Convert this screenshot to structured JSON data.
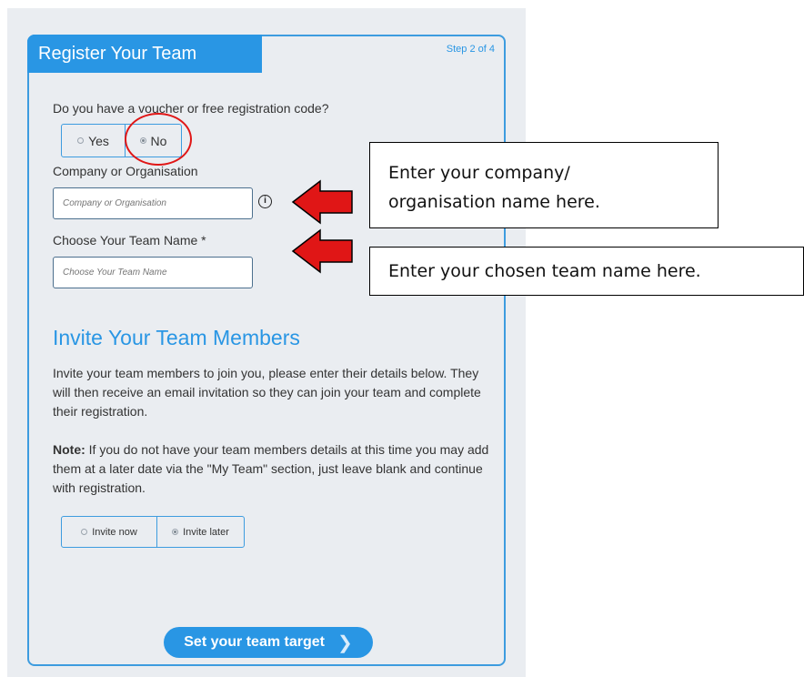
{
  "form": {
    "title": "Register Your Team",
    "step": "Step 2 of 4",
    "voucher_question": "Do you have a voucher or free registration code?",
    "voucher_options": [
      "Yes",
      "No"
    ],
    "voucher_selected": "No",
    "company_label": "Company or Organisation",
    "company_placeholder": "Company or Organisation",
    "info_icon": "info-circle-icon",
    "team_name_label": "Choose Your Team Name *",
    "team_name_placeholder": "Choose Your Team Name"
  },
  "invite": {
    "heading": "Invite Your Team Members",
    "intro": "Invite your team members to join you, please enter their details below. They will then receive an email invitation so they can join your team and complete their registration.",
    "note_label": "Note:",
    "note_text": " If you do not have your team members details at this time you may add them at a later date via the \"My Team\" section, just leave blank and continue with registration.",
    "options": [
      "Invite now",
      "Invite later"
    ],
    "selected": "Invite later"
  },
  "cta": {
    "label": "Set your team target",
    "icon": "chevron-right-icon"
  },
  "annotations": {
    "company_callout_line1": "Enter your company/",
    "company_callout_line2": "organisation name here.",
    "team_callout": "Enter your chosen team name here.",
    "arrow_color": "#e01616",
    "highlight_color": "#e01616"
  },
  "colors": {
    "accent": "#2996e4",
    "background": "#eaedf1"
  }
}
